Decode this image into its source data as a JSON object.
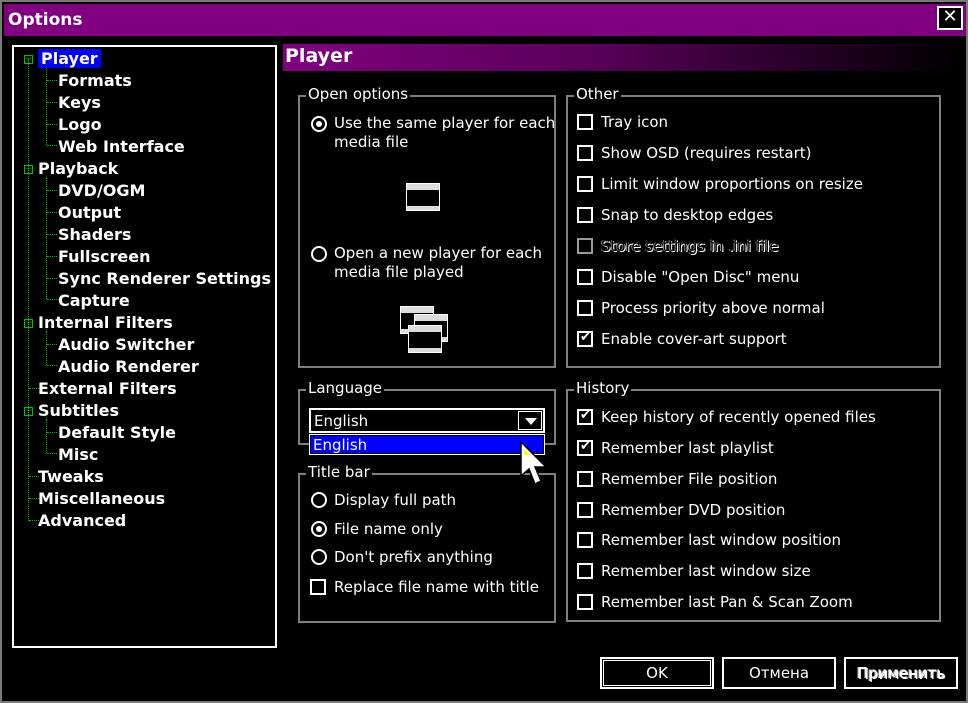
{
  "window": {
    "title": "Options"
  },
  "tree": {
    "items": [
      {
        "label": "Player",
        "level": 0,
        "selected": true,
        "expander": true
      },
      {
        "label": "Formats",
        "level": 1
      },
      {
        "label": "Keys",
        "level": 1
      },
      {
        "label": "Logo",
        "level": 1
      },
      {
        "label": "Web Interface",
        "level": 1
      },
      {
        "label": "Playback",
        "level": 0,
        "expander": true
      },
      {
        "label": "DVD/OGM",
        "level": 1
      },
      {
        "label": "Output",
        "level": 1
      },
      {
        "label": "Shaders",
        "level": 1
      },
      {
        "label": "Fullscreen",
        "level": 1
      },
      {
        "label": "Sync Renderer Settings",
        "level": 1
      },
      {
        "label": "Capture",
        "level": 1
      },
      {
        "label": "Internal Filters",
        "level": 0,
        "expander": true
      },
      {
        "label": "Audio Switcher",
        "level": 1
      },
      {
        "label": "Audio Renderer",
        "level": 1
      },
      {
        "label": "External Filters",
        "level": 0
      },
      {
        "label": "Subtitles",
        "level": 0,
        "expander": true
      },
      {
        "label": "Default Style",
        "level": 1
      },
      {
        "label": "Misc",
        "level": 1
      },
      {
        "label": "Tweaks",
        "level": 0
      },
      {
        "label": "Miscellaneous",
        "level": 0
      },
      {
        "label": "Advanced",
        "level": 0
      }
    ]
  },
  "page": {
    "title": "Player"
  },
  "open_options": {
    "legend": "Open options",
    "same_player_line1": "Use the same player for each",
    "same_player_line2": "media file",
    "new_player_line1": "Open a new player for each",
    "new_player_line2": "media file played"
  },
  "other": {
    "legend": "Other",
    "items": [
      {
        "label": "Tray icon",
        "checked": false
      },
      {
        "label": "Show OSD (requires restart)",
        "checked": false
      },
      {
        "label": "Limit window proportions on resize",
        "checked": false
      },
      {
        "label": "Snap to desktop edges",
        "checked": false
      },
      {
        "label": "Store settings in .ini file",
        "checked": false,
        "disabled": true
      },
      {
        "label": "Disable \"Open Disc\" menu",
        "checked": false
      },
      {
        "label": "Process priority above normal",
        "checked": false
      },
      {
        "label": "Enable cover-art support",
        "checked": true
      }
    ]
  },
  "language": {
    "legend": "Language",
    "selected": "English",
    "dropdown_item": "English"
  },
  "title_bar": {
    "legend": "Title bar",
    "display_full_path": "Display full path",
    "file_name_only": "File name only",
    "dont_prefix": "Don't prefix anything",
    "replace_with_title": "Replace file name with title"
  },
  "history": {
    "legend": "History",
    "items": [
      {
        "label": "Keep history of recently opened files",
        "checked": true
      },
      {
        "label": "Remember last playlist",
        "checked": true
      },
      {
        "label": "Remember File position",
        "checked": false
      },
      {
        "label": "Remember DVD position",
        "checked": false
      },
      {
        "label": "Remember last window position",
        "checked": false
      },
      {
        "label": "Remember last window size",
        "checked": false
      },
      {
        "label": "Remember last Pan & Scan Zoom",
        "checked": false
      }
    ]
  },
  "buttons": {
    "ok": "OK",
    "cancel": "Отмена",
    "apply": "Применить"
  },
  "colors": {
    "title_bar": "#800080",
    "selection": "#0000ff",
    "tree_lines": "#00c000"
  }
}
